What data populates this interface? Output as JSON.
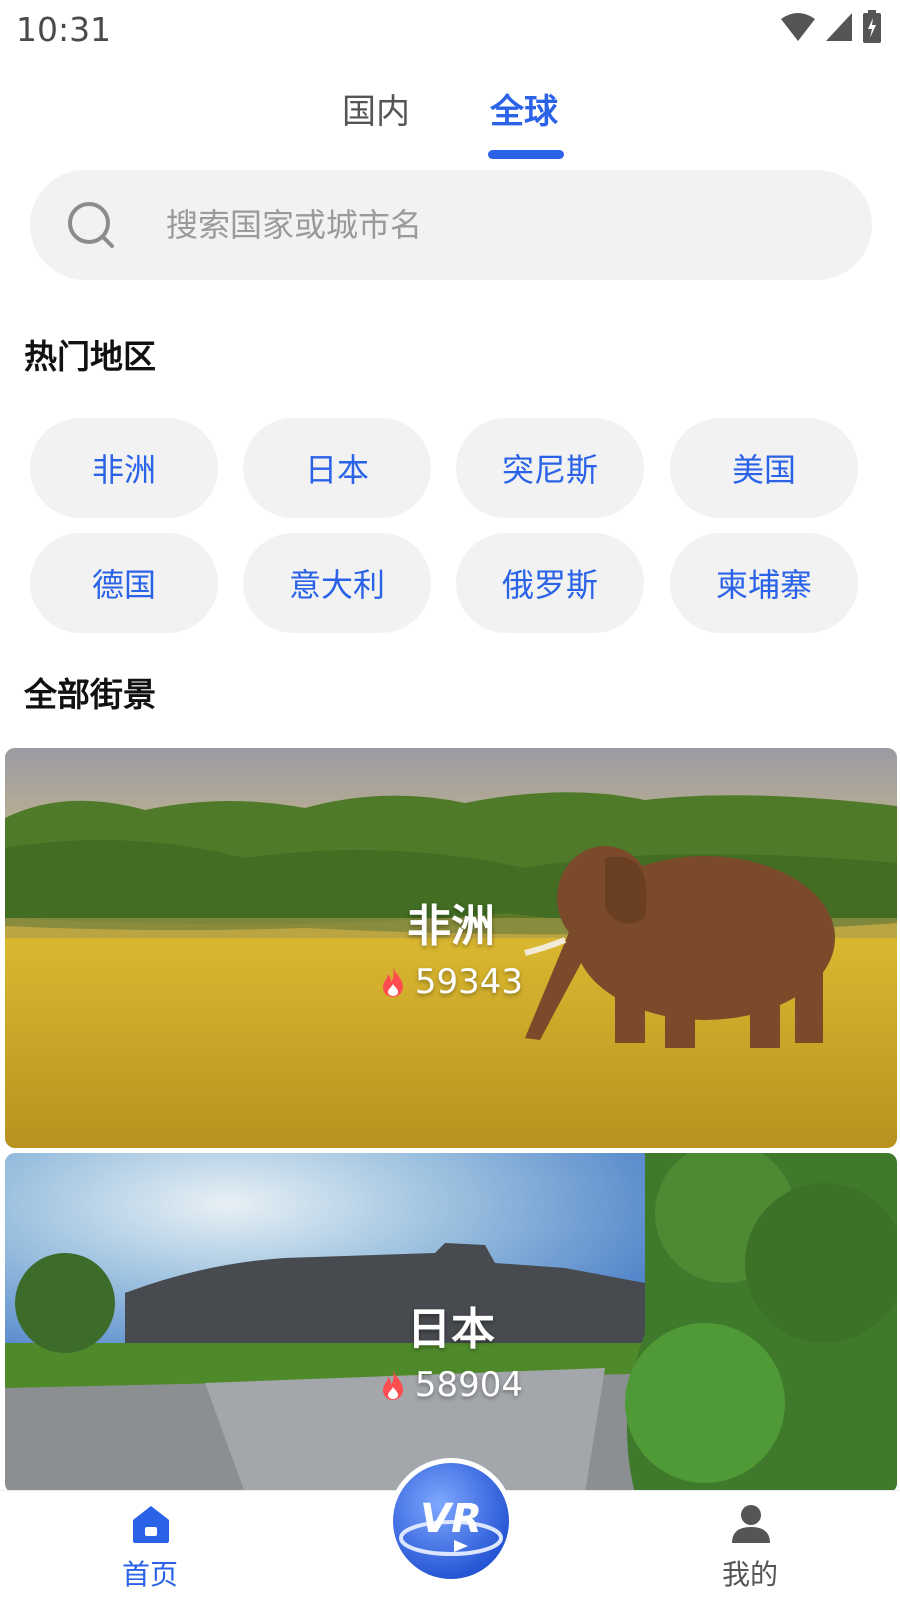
{
  "status_bar": {
    "time": "10:31",
    "icons": [
      "wifi-icon",
      "cell-signal-icon",
      "battery-charging-icon"
    ]
  },
  "tabs": [
    {
      "label": "国内",
      "selected": false
    },
    {
      "label": "全球",
      "selected": true
    }
  ],
  "search": {
    "placeholder": "搜索国家或城市名",
    "value": ""
  },
  "hot_regions": {
    "title": "热门地区",
    "items": [
      "非洲",
      "日本",
      "突尼斯",
      "美国",
      "德国",
      "意大利",
      "俄罗斯",
      "柬埔寨"
    ]
  },
  "all_streetview": {
    "title": "全部街景",
    "cards": [
      {
        "title": "非洲",
        "count": "59343",
        "icon": "fire-icon"
      },
      {
        "title": "日本",
        "count": "58904",
        "icon": "fire-icon"
      }
    ]
  },
  "bottom_nav": {
    "home_label": "首页",
    "me_label": "我的",
    "center_label": "VR"
  },
  "colors": {
    "accent": "#2a63e8",
    "chip_bg": "#f2f2f2",
    "fire": "#ff4d4f"
  }
}
